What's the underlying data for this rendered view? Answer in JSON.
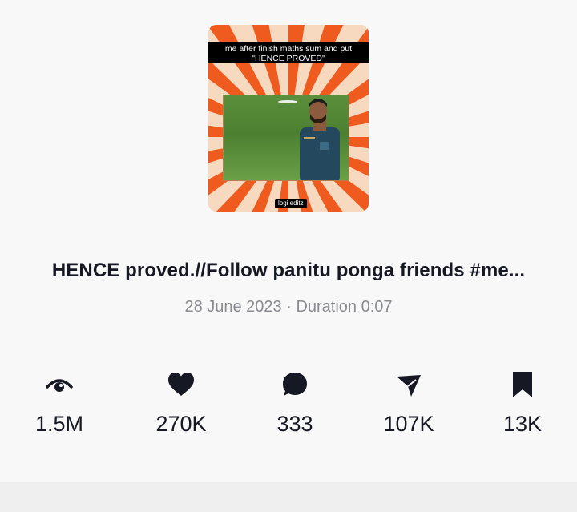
{
  "thumbnail": {
    "caption_line1": "me after finish maths sum and put",
    "caption_line2": "\"HENCE PROVED\"",
    "watermark": "logi editz",
    "colors": {
      "burst": "#ef5a1f",
      "background": "#f7d9bf"
    }
  },
  "video": {
    "title": "HENCE proved.//Follow panitu ponga friends #me...",
    "meta": "28 June 2023 · Duration 0:07"
  },
  "stats": [
    {
      "icon": "eye-icon",
      "value": "1.5M"
    },
    {
      "icon": "heart-icon",
      "value": "270K"
    },
    {
      "icon": "comment-icon",
      "value": "333"
    },
    {
      "icon": "share-icon",
      "value": "107K"
    },
    {
      "icon": "bookmark-icon",
      "value": "13K"
    }
  ]
}
